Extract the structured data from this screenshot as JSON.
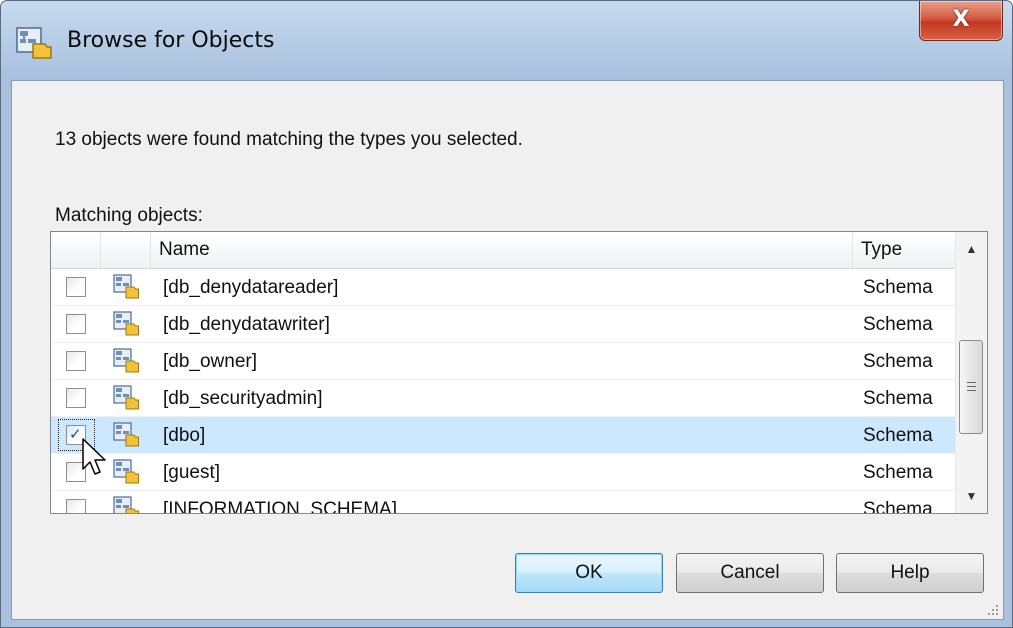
{
  "window": {
    "title": "Browse for Objects",
    "close_glyph": "X",
    "icon": "schema-object-icon"
  },
  "message": "13 objects were found matching the types you selected.",
  "matching_label": "Matching objects:",
  "list": {
    "columns": {
      "name": "Name",
      "type": "Type"
    },
    "rows": [
      {
        "name": "[db_denydatareader]",
        "type": "Schema",
        "checked": false
      },
      {
        "name": "[db_denydatawriter]",
        "type": "Schema",
        "checked": false
      },
      {
        "name": "[db_owner]",
        "type": "Schema",
        "checked": false
      },
      {
        "name": "[db_securityadmin]",
        "type": "Schema",
        "checked": false
      },
      {
        "name": "[dbo]",
        "type": "Schema",
        "checked": true,
        "selected": true
      },
      {
        "name": "[guest]",
        "type": "Schema",
        "checked": false
      },
      {
        "name": "[INFORMATION_SCHEMA]",
        "type": "Schema",
        "checked": false
      }
    ]
  },
  "buttons": {
    "ok": "OK",
    "cancel": "Cancel",
    "help": "Help"
  },
  "colors": {
    "selection": "#cce8ff",
    "close_button": "#c2381f",
    "default_button_border": "#3c7fb1"
  }
}
